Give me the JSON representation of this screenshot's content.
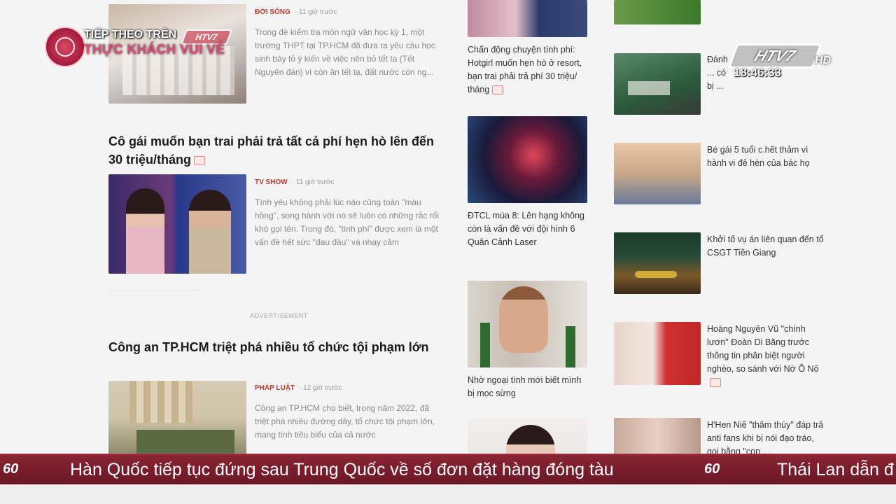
{
  "overlay": {
    "next_label": "TIẾP THEO TRÊN",
    "next_show": "THỰC KHÁCH VUI VẺ",
    "channel_small": "HTV7",
    "channel": "HTV7",
    "hd": "HD",
    "clock": "18:46:33"
  },
  "main": {
    "article1": {
      "category": "ĐỜI SỐNG",
      "time": "11 giờ trước",
      "summary": "Trong đề kiểm tra môn ngữ văn học kỳ 1, một trường THPT tại TP.HCM đã đưa ra yêu cầu học sinh bày tỏ ý kiến về việc nên bỏ tết ta (Tết Nguyên đán) vì còn ăn tết tạ, đất nước còn ng..."
    },
    "article2": {
      "title": "Cô gái muốn bạn trai phải trả tất cả phí hẹn hò lên đến 30 triệu/tháng",
      "category": "TV SHOW",
      "time": "11 giờ trước",
      "summary": "Tình yêu không phải lúc nào cũng toàn \"màu hồng\", song hành với nó sẽ luôn có những rắc rối khó gọi tên. Trong đó, \"tình phí\" được xem là một vấn đề hết sức \"đau đầu\" và nhạy cảm"
    },
    "ad_label": "ADVERTISEMENT",
    "article3": {
      "title": "Công an TP.HCM triệt phá nhiều tổ chức tội phạm lớn",
      "category": "PHÁP LUẬT",
      "time": "12 giờ trước",
      "summary": "Công an TP.HCM cho biết, trong năm 2022, đã triệt phá nhiều đường dây, tổ chức tội phạm lớn, mang tính tiêu biểu của cả nước"
    }
  },
  "middle": [
    {
      "title": "Chấn động chuyện tình phí: Hotgirl muốn hẹn hò ở resort, bạn trai phải trả phí 30 triệu/ tháng"
    },
    {
      "title": "ĐTCL mùa 8: Lên hạng không còn là vấn đề với đội hình 6 Quân Cảnh Laser"
    },
    {
      "title": "Nhờ ngoại tình mới biết mình bị mọc sừng"
    }
  ],
  "right": [
    {
      "title": "Đánh ... có bị ..."
    },
    {
      "title": "Bé gái 5 tuổi c.hết thảm vì hành vi đê hèn của bác họ"
    },
    {
      "title": "Khởi tố vụ án liên quan đến tổ CSGT Tiền Giang"
    },
    {
      "title": "Hoàng Nguyên Vũ \"chính lươn\" Đoàn Di Băng trước thông tin phân biệt người nghèo, so sánh với Nờ Ô Nô"
    },
    {
      "title": "H'Hen Niê \"thâm thúy\" đáp trả anti fans khi bị nói đạo tráo, gọi bằng \"con ..."
    }
  ],
  "ticker": {
    "logo": "60",
    "headline1": "Hàn Quốc tiếp tục đứng sau Trung Quốc về số đơn đặt hàng đóng tàu",
    "headline2": "Thái Lan dẫn đ"
  }
}
